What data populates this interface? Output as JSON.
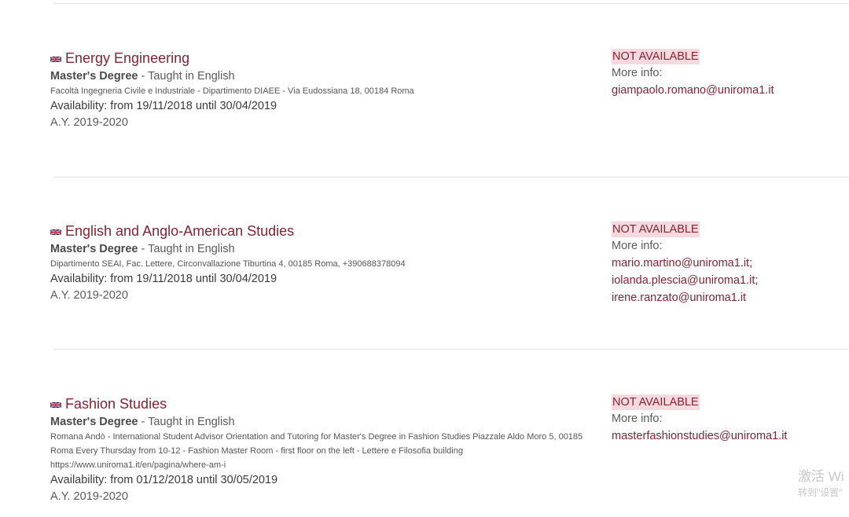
{
  "courses": [
    {
      "title": "Energy Engineering",
      "degree": "Master's Degree",
      "degree_suffix": " - Taught in English",
      "address": "Facoltà Ingegneria Civile e Industriale - Dipartimento DIAEE - Via Eudossiana 18, 00184 Roma",
      "availability": "Availability: from 19/11/2018 until 30/04/2019",
      "academic_year": "A.Y. 2019-2020",
      "status": "NOT AVAILABLE",
      "more_info_label": "More info:",
      "emails": [
        "giampaolo.romano@uniroma1.it"
      ]
    },
    {
      "title": "English and Anglo-American Studies",
      "degree": "Master's Degree",
      "degree_suffix": " - Taught in English",
      "address": "Dipartimento SEAI, Fac. Lettere, Circonvallazione Tiburtina 4, 00185 Roma, +390688378094",
      "availability": "Availability: from 19/11/2018 until 30/04/2019",
      "academic_year": "A.Y. 2019-2020",
      "status": "NOT AVAILABLE",
      "more_info_label": "More info:",
      "emails": [
        "mario.martino@uniroma1.it;",
        "iolanda.plescia@uniroma1.it;",
        "irene.ranzato@uniroma1.it"
      ]
    },
    {
      "title": "Fashion Studies",
      "degree": "Master's Degree",
      "degree_suffix": " - Taught in English",
      "address": "Romana Andò - International Student Advisor Orientation and Tutoring for Master's Degree in Fashion Studies Piazzale Aldo Moro 5, 00185 Roma Every Thursday from 10-12 - Fashion Master Room - first floor on the left - Lettere e Filosofia building https://www.uniroma1.it/en/pagina/where-am-i",
      "availability": "Availability: from 01/12/2018 until 30/05/2019",
      "academic_year": "A.Y. 2019-2020",
      "status": "NOT AVAILABLE",
      "more_info_label": "More info:",
      "emails": [
        "masterfashionstudies@uniroma1.it"
      ]
    }
  ],
  "watermark": {
    "line1": "激活 Wi",
    "line2": "转到\"设置\""
  },
  "colors": {
    "accent": "#822433",
    "badge_bg": "#f6d9de",
    "divider": "#e3e3e3"
  },
  "icons": {
    "flag": "uk-flag-icon"
  }
}
